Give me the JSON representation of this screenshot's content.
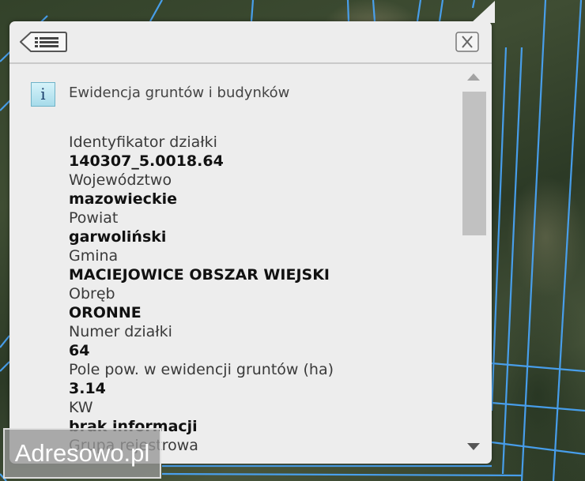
{
  "popup": {
    "layer_title": "Ewidencja gruntów i budynków",
    "fields": [
      {
        "label": "Identyfikator działki",
        "value": "140307_5.0018.64"
      },
      {
        "label": "Województwo",
        "value": "mazowieckie"
      },
      {
        "label": "Powiat",
        "value": "garwoliński"
      },
      {
        "label": "Gmina",
        "value": "MACIEJOWICE OBSZAR WIEJSKI"
      },
      {
        "label": "Obręb",
        "value": "ORONNE"
      },
      {
        "label": "Numer działki",
        "value": "64"
      },
      {
        "label": "Pole pow. w ewidencji gruntów (ha)",
        "value": "3.14"
      },
      {
        "label": "KW",
        "value": "brak informacji"
      },
      {
        "label": "Grupa rejestrowa",
        "value": ""
      }
    ]
  },
  "icons": {
    "back": "list-back-icon",
    "close": "close-icon",
    "info": "info-icon",
    "info_glyph": "i"
  },
  "watermark": "Adresowo.pl",
  "colors": {
    "parcel_lines": "#4aa8ff",
    "popup_bg": "#ededed"
  }
}
